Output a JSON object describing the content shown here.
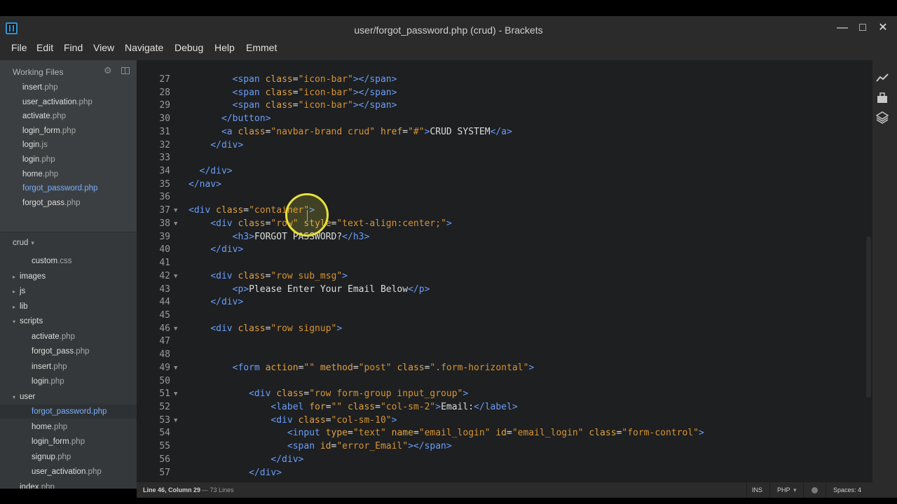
{
  "window": {
    "title": "user/forgot_password.php (crud) - Brackets",
    "controls": {
      "minimize": "—",
      "maximize": "□",
      "close": "✕"
    }
  },
  "menu": [
    "File",
    "Edit",
    "Find",
    "View",
    "Navigate",
    "Debug",
    "Help",
    "Emmet"
  ],
  "sidebar": {
    "working_files_label": "Working Files",
    "working_files": [
      {
        "name": "insert",
        "ext": ".php"
      },
      {
        "name": "user_activation",
        "ext": ".php"
      },
      {
        "name": "activate",
        "ext": ".php"
      },
      {
        "name": "login_form",
        "ext": ".php"
      },
      {
        "name": "login",
        "ext": ".js"
      },
      {
        "name": "login",
        "ext": ".php"
      },
      {
        "name": "home",
        "ext": ".php"
      },
      {
        "name": "forgot_password",
        "ext": ".php",
        "active": true
      },
      {
        "name": "forgot_pass",
        "ext": ".php"
      }
    ],
    "project_label": "crud",
    "project_caret": "▾",
    "tree": [
      {
        "indent": 2,
        "name": "custom",
        "ext": ".css"
      },
      {
        "indent": 1,
        "folder": true,
        "open": false,
        "name": "images"
      },
      {
        "indent": 1,
        "folder": true,
        "open": false,
        "name": "js"
      },
      {
        "indent": 1,
        "folder": true,
        "open": false,
        "name": "lib"
      },
      {
        "indent": 1,
        "folder": true,
        "open": true,
        "name": "scripts"
      },
      {
        "indent": 2,
        "name": "activate",
        "ext": ".php"
      },
      {
        "indent": 2,
        "name": "forgot_pass",
        "ext": ".php"
      },
      {
        "indent": 2,
        "name": "insert",
        "ext": ".php"
      },
      {
        "indent": 2,
        "name": "login",
        "ext": ".php"
      },
      {
        "indent": 1,
        "folder": true,
        "open": true,
        "name": "user"
      },
      {
        "indent": 2,
        "name": "forgot_password",
        "ext": ".php",
        "selected": true
      },
      {
        "indent": 2,
        "name": "home",
        "ext": ".php"
      },
      {
        "indent": 2,
        "name": "login_form",
        "ext": ".php"
      },
      {
        "indent": 2,
        "name": "signup",
        "ext": ".php"
      },
      {
        "indent": 2,
        "name": "user_activation",
        "ext": ".php"
      },
      {
        "indent": 1,
        "name": "index",
        "ext": ".php"
      }
    ]
  },
  "editor": {
    "lines": [
      {
        "n": 27,
        "fold": false,
        "html": "        <t>&lt;span</t> <a>class</a><x>=</x><s>\"icon-bar\"</s><t>&gt;&lt;/span&gt;</t>"
      },
      {
        "n": 28,
        "fold": false,
        "html": "        <t>&lt;span</t> <a>class</a><x>=</x><s>\"icon-bar\"</s><t>&gt;&lt;/span&gt;</t>"
      },
      {
        "n": 29,
        "fold": false,
        "html": "        <t>&lt;span</t> <a>class</a><x>=</x><s>\"icon-bar\"</s><t>&gt;&lt;/span&gt;</t>"
      },
      {
        "n": 30,
        "fold": false,
        "html": "      <t>&lt;/button&gt;</t>"
      },
      {
        "n": 31,
        "fold": false,
        "html": "      <t>&lt;a</t> <a>class</a><x>=</x><s>\"navbar-brand crud\"</s> <a>href</a><x>=</x><s>\"#\"</s><t>&gt;</t><x>CRUD SYSTEM</x><t>&lt;/a&gt;</t>"
      },
      {
        "n": 32,
        "fold": false,
        "html": "    <t>&lt;/div&gt;</t>"
      },
      {
        "n": 33,
        "fold": false,
        "html": ""
      },
      {
        "n": 34,
        "fold": false,
        "html": "  <t>&lt;/div&gt;</t>"
      },
      {
        "n": 35,
        "fold": false,
        "html": "<t>&lt;/nav&gt;</t>"
      },
      {
        "n": 36,
        "fold": false,
        "html": ""
      },
      {
        "n": 37,
        "fold": true,
        "html": "<t>&lt;div</t> <a>class</a><x>=</x><s>\"container\"</s><t>&gt;</t>"
      },
      {
        "n": 38,
        "fold": true,
        "html": "    <t>&lt;div</t> <a>class</a><x>=</x><s>\"row\"</s> <a>style</a><x>=</x><s>\"text-align:center;\"</s><t>&gt;</t>"
      },
      {
        "n": 39,
        "fold": false,
        "html": "        <t>&lt;h3&gt;</t><x>FORGOT PASSWORD?</x><t>&lt;/h3&gt;</t>"
      },
      {
        "n": 40,
        "fold": false,
        "html": "    <t>&lt;/div&gt;</t>"
      },
      {
        "n": 41,
        "fold": false,
        "html": ""
      },
      {
        "n": 42,
        "fold": true,
        "html": "    <t>&lt;div</t> <a>class</a><x>=</x><s>\"row sub_msg\"</s><t>&gt;</t>"
      },
      {
        "n": 43,
        "fold": false,
        "html": "        <t>&lt;p&gt;</t><x>Please Enter Your Email Below</x><t>&lt;/p&gt;</t>"
      },
      {
        "n": 44,
        "fold": false,
        "html": "    <t>&lt;/div&gt;</t>"
      },
      {
        "n": 45,
        "fold": false,
        "html": ""
      },
      {
        "n": 46,
        "fold": true,
        "html": "    <t>&lt;div</t> <a>class</a><x>=</x><s>\"row signup\"</s><t>&gt;</t>"
      },
      {
        "n": 47,
        "fold": false,
        "html": ""
      },
      {
        "n": 48,
        "fold": false,
        "html": ""
      },
      {
        "n": 49,
        "fold": true,
        "html": "        <t>&lt;form</t> <a>action</a><x>=</x><s>\"\"</s> <a>method</a><x>=</x><s>\"post\"</s> <a>class</a><x>=</x><s>\".form-horizontal\"</s><t>&gt;</t>"
      },
      {
        "n": 50,
        "fold": false,
        "html": ""
      },
      {
        "n": 51,
        "fold": true,
        "html": "           <t>&lt;div</t> <a>class</a><x>=</x><s>\"row form-group input_group\"</s><t>&gt;</t>"
      },
      {
        "n": 52,
        "fold": false,
        "html": "               <t>&lt;label</t> <a>for</a><x>=</x><s>\"\"</s> <a>class</a><x>=</x><s>\"col-sm-2\"</s><t>&gt;</t><x>Email:</x><t>&lt;/label&gt;</t>"
      },
      {
        "n": 53,
        "fold": true,
        "html": "               <t>&lt;div</t> <a>class</a><x>=</x><s>\"col-sm-10\"</s><t>&gt;</t>"
      },
      {
        "n": 54,
        "fold": false,
        "html": "                  <t>&lt;input</t> <a>type</a><x>=</x><s>\"text\"</s> <a>name</a><x>=</x><s>\"email_login\"</s> <a>id</a><x>=</x><s>\"email_login\"</s> <a>class</a><x>=</x><s>\"form-control\"</s><t>&gt;</t>"
      },
      {
        "n": 55,
        "fold": false,
        "html": "                  <t>&lt;span</t> <a>id</a><x>=</x><s>\"error_Email\"</s><t>&gt;&lt;/span&gt;</t>"
      },
      {
        "n": 56,
        "fold": false,
        "html": "               <t>&lt;/div&gt;</t>"
      },
      {
        "n": 57,
        "fold": false,
        "html": "           <t>&lt;/div&gt;</t>"
      }
    ]
  },
  "status": {
    "position": "Line 46, Column 29",
    "line_count": "— 73 Lines",
    "mode": "INS",
    "language": "PHP",
    "language_caret": "▾",
    "spaces": "Spaces: 4"
  },
  "colors": {
    "tag": "#6c9ef8",
    "attribute": "#e0a043",
    "string": "#d89333",
    "text": "#dddddd",
    "active_file": "#7ab0ff"
  },
  "icons": {
    "live_preview": "live-preview-icon",
    "extension_manager": "extension-manager-icon",
    "layers": "layers-icon",
    "gear": "gear-icon",
    "split_view": "split-view-icon"
  }
}
